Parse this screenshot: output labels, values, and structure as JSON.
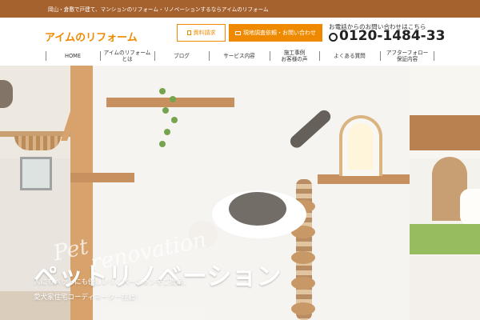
{
  "topbar": {
    "text": "岡山・倉敷で戸建て、マンションのリフォーム・リノベーションするならアイムのリフォーム"
  },
  "header": {
    "logo": "アイムのリフォーム",
    "document_button": "資料請求",
    "visit_button": "現地調査依頼・お問い合わせ",
    "phone_caption": "お電話からのお問い合わせはこちら",
    "phone_number": "0120-1484-33"
  },
  "nav": {
    "items": [
      {
        "label": "HOME"
      },
      {
        "label": "アイムのリフォーム\nとは"
      },
      {
        "label": "ブログ"
      },
      {
        "label": "サービス内容"
      },
      {
        "label": "施工事例\nお客様の声"
      },
      {
        "label": "よくある質問"
      },
      {
        "label": "アフターフォロー\n保証内容"
      }
    ]
  },
  "hero": {
    "script_line1": "Pet",
    "script_line2": "renovation",
    "title": "ペットリノベーション",
    "line1": "人にもペットにも優しいリノベーションをご提案。",
    "line2": "愛犬家住宅コーディネーター在籍！"
  },
  "colors": {
    "brand_orange": "#ef8a00",
    "topbar_brown": "#a5612e",
    "wood": "#c48c57"
  },
  "icons": {
    "document": "document-icon",
    "mail": "mail-icon",
    "phone": "phone-icon"
  }
}
